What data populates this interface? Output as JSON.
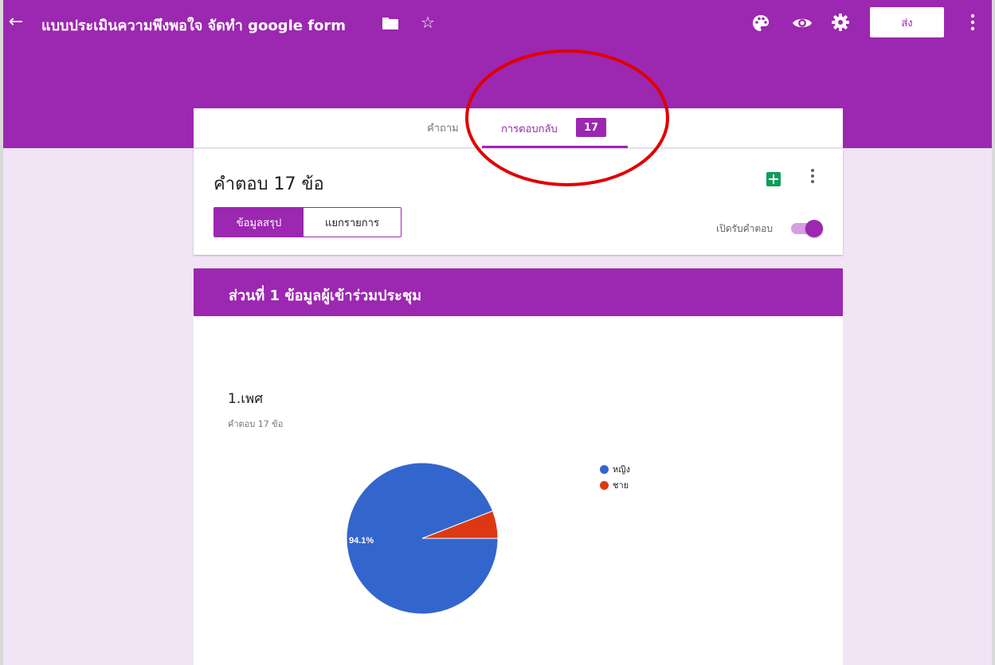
{
  "header": {
    "form_title": "แบบประเมินความพึงพอใจ จัดทำ google form",
    "send_label": "ส่ง"
  },
  "tabs": {
    "questions_label": "คำถาม",
    "responses_label": "การตอบกลับ",
    "responses_count": "17"
  },
  "summary": {
    "response_count_label": "คำตอบ 17 ข้อ",
    "segment_summary": "ข้อมูลสรุป",
    "segment_individual": "แยกรายการ",
    "accepting_label": "เปิดรับคำตอบ",
    "accepting": true
  },
  "section": {
    "title": "ส่วนที่ 1 ข้อมูลผู้เข้าร่วมประชุม"
  },
  "question": {
    "title": "1.เพศ",
    "subtitle": "คำตอบ 17 ข้อ"
  },
  "colors": {
    "primary": "#9c27b0",
    "pie_female": "#3366cc",
    "pie_male": "#dc3912",
    "annotation": "#e00000"
  },
  "chart_data": {
    "type": "pie",
    "title": "",
    "categories": [
      "หญิง",
      "ชาย"
    ],
    "values": [
      94.1,
      5.9
    ],
    "data_labels": [
      "94.1%",
      ""
    ],
    "legend_position": "right"
  }
}
